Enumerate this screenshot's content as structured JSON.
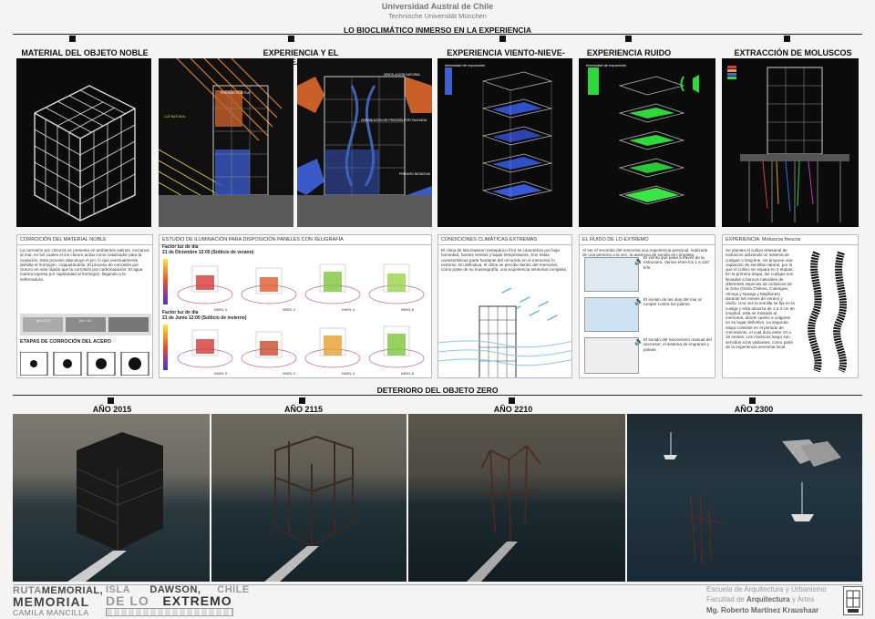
{
  "header": {
    "university": "Universidad Austral de Chile",
    "university2": "Technische Universität München",
    "main_title": "LO BIOCLIMÁTICO INMERSO EN LA  EXPERIENCIA"
  },
  "top_sections": [
    {
      "title": "MATERIAL DEL OBJETO NOBLE"
    },
    {
      "title": "EXPERIENCIA Y EL ASOLEAMIENTO"
    },
    {
      "title": "EXPERIENCIA VIENTO-NIEVE-LLUVIA"
    },
    {
      "title": "EXPERIENCIA RUIDO"
    },
    {
      "title": "EXTRACCIÓN DE MOLUSCOS"
    }
  ],
  "sun_labels": {
    "a": "PRESIÓN POSITIVA",
    "b": "LUZ NATURAL",
    "c": "VENTILACIÓN NATURAL",
    "d": "DISMINUCIÓN DE PRESIÓN POR FACHADA",
    "e": "PRESIÓN NEGATIVA"
  },
  "panels": {
    "corrosion": {
      "title": "CORROCIÓN DEL MATERIAL NOBLE",
      "text": "La corrosión por cloruros se presenta en ambientes salinos, cercanos al mar, en los cuales el ion cloruro actúa como catalizador para la oxidación. Este proceso disminuye el pH, lo que eventualmente debilita el hormigón, craquelándolo. El proceso de corrosión por cloruro es más rápido que la corrosión por carbonatación. El agua marina ingresa por capilaridad al hormigón, llegando a la enfierradura.",
      "stages": "ETAPAS DE CORROCIÓN DEL ACERO",
      "ph1": "pH ≤ 12.5",
      "ph2": "pH = 9.5"
    },
    "light": {
      "title": "ESTUDIO DE ILUMINACIÓN PARA DISPOSICIÓN PANELES CON XELIGRAFÍA",
      "f1": "Factor luz de día",
      "f1b": "21 de Diciembre 12:00 (Solticio de verano)",
      "f2": "Factor luz de día",
      "f2b": "21 de Junio 12:00 (Solticio de invierno)",
      "levels": [
        "NIVEL 0",
        "NIVEL 2",
        "NIVEL 4",
        "NIVEL 6"
      ]
    },
    "climate": {
      "title": "CONDICIONES CLIMÁTICAS EXTREMAS",
      "text": "El clima de Isla Dawson (estepárico frío) se caracteriza por baja humedad, fuertes vientos y bajas temperaturas. Son estas características parte fundante del recorrido en el memorial; lo extremo. En definitiva, el clima se percibe dentro del memorial, como parte de su museografía, una experiencia sensorial completa."
    },
    "noise": {
      "title": "EL RUIDO DE LO EXTREMO",
      "text": "Al ser el recorrido del memorial una experiencia personal, realizada de una persona a la vez, la ausencia de sonido es completa.",
      "n1": "El viento que pasa a través de la estructura. Varían entre los 1 a 120 k/hr.",
      "n2": "El sonido de las olas del mar al romper contra los pilares.",
      "n3": "El sonido del mecanismo manual del ascensor; el sistema de engranes y poleas."
    },
    "mollusc": {
      "title": "EXPERIENCIA: Moluscos frescos",
      "text": "Se plantea el cultivo artesanal de moluscos utilizando un sistema de cuelgas o long-line. Se propone una captación de semillas natural, por lo que el cultivo se separa en 2 etapas: En la primera etapa, las cuelgas son llevadas a bancos naturales de diferentes especies de moluscos de la zona (Ostra Chilena, Culengue, Almeja y Navaja y Mejillones) durante los meses de verano y otoño. Una vez la semilla se fija en la cuelga y esta alcanza de 1 a 3 cm de longitud, esta se traslada al memorial, donde vuelve a colgarse en su lugar definitivo. La segunda etapa consiste en el periodo de crecimiento, el cual dura entre 10 a 18 meses. Los mariscos luego son servidos a los visitantes, como parte de la experiencia sensorial local."
    }
  },
  "deterioro": {
    "title": "DETERIORO DEL OBJETO ZERO",
    "years": [
      "AÑO 2015",
      "AÑO 2115",
      "AÑO 2210",
      "AÑO 2300"
    ]
  },
  "footer": {
    "l1a": "RUTA",
    "l1b": "MEMORIAL,",
    "l2": "MEMORIAL",
    "l3": "CAMILA MANCILLA",
    "c1a": "ISLA",
    "c1b": "DAWSON,",
    "c1c": "CHILE",
    "c2a": "DE LO",
    "c2b": "EXTREMO",
    "r1": "Escuela de Arquitectura y Urbanismo",
    "r2a": "Facultad de ",
    "r2b": "Arquitectura",
    "r2c": " y Artes",
    "r3": "Mg. Roberto Martínez Kraushaar"
  },
  "colors": {
    "accent_blue": "#3050c8",
    "accent_green": "#2ed83a",
    "accent_orange": "#e07a20"
  }
}
